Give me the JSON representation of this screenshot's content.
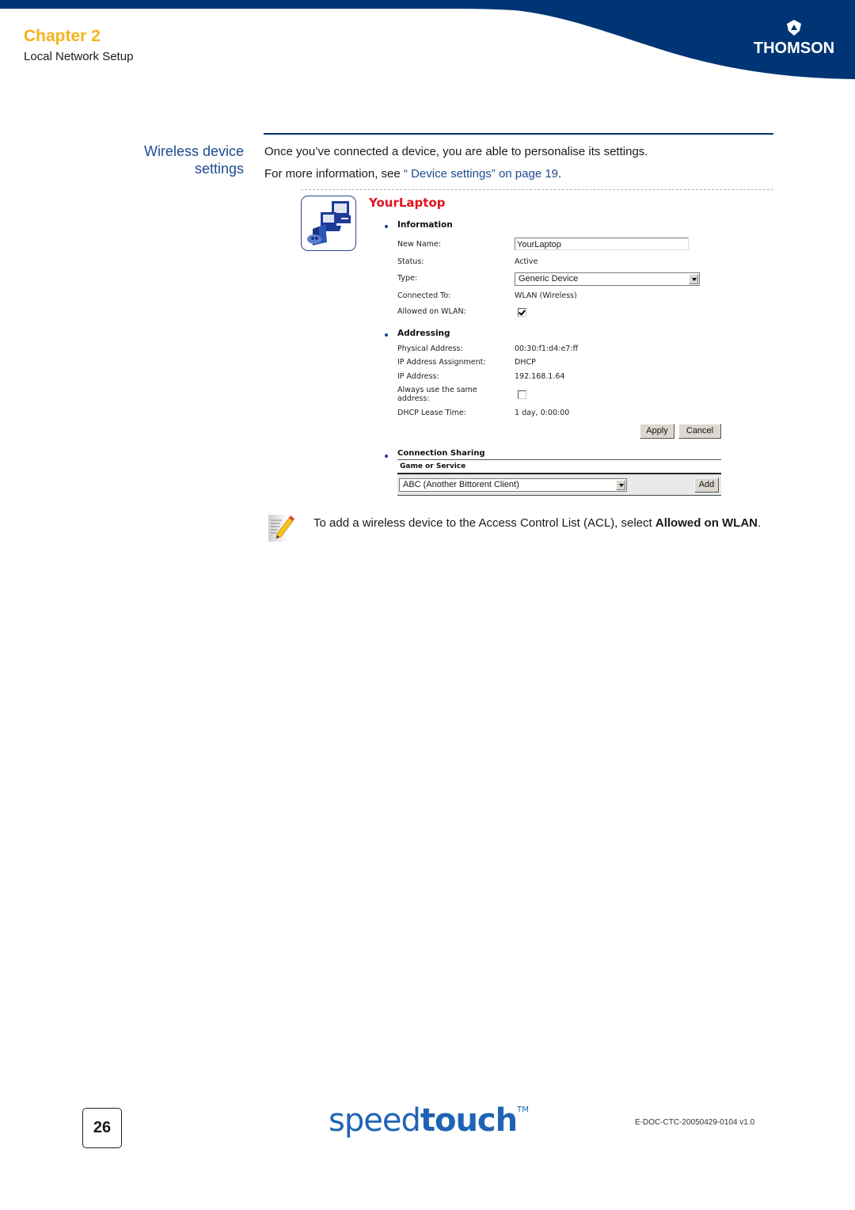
{
  "header": {
    "chapter_label": "Chapter 2",
    "chapter_subtitle": "Local Network Setup",
    "brand_logo_text": "THOMSON",
    "brand_logo_icon": "thomson-triangle-mark",
    "band_color": "#003575",
    "chapter_color": "#f5b21a"
  },
  "section": {
    "heading_line1": "Wireless device",
    "heading_line2": "settings",
    "intro_text": "Once you’ve connected a device, you are able to personalise its settings.",
    "more_info_prefix": "For more information, see ",
    "more_info_link": "“ Device settings” on page 19",
    "more_info_suffix": "."
  },
  "screenshot": {
    "device_icon": "game-console-computers-icon",
    "device_name": "YourLaptop",
    "information": {
      "title": "Information",
      "fields": {
        "new_name_label": "New Name:",
        "new_name_value": "YourLaptop",
        "status_label": "Status:",
        "status_value": "Active",
        "type_label": "Type:",
        "type_value": "Generic Device",
        "connected_to_label": "Connected To:",
        "connected_to_value": "WLAN (Wireless)",
        "allowed_on_wlan_label": "Allowed on WLAN:",
        "allowed_on_wlan_checked": true
      }
    },
    "addressing": {
      "title": "Addressing",
      "fields": {
        "physical_address_label": "Physical Address:",
        "physical_address_value": "00:30:f1:d4:e7:ff",
        "ip_assignment_label": "IP Address Assignment:",
        "ip_assignment_value": "DHCP",
        "ip_address_label": "IP Address:",
        "ip_address_value": "192.168.1.64",
        "always_same_label_1": "Always use the same",
        "always_same_label_2": "address:",
        "always_same_checked": false,
        "lease_time_label": "DHCP Lease Time:",
        "lease_time_value": "1 day, 0:00:00"
      },
      "apply_label": "Apply",
      "cancel_label": "Cancel"
    },
    "connection_sharing": {
      "title": "Connection Sharing",
      "column_header": "Game or Service",
      "selected_service": "ABC (Another Bittorent Client)",
      "add_label": "Add"
    }
  },
  "note": {
    "icon": "note-pencil-icon",
    "text_prefix": "To add a wireless device to the Access Control List (ACL), select ",
    "text_bold": "Allowed on WLAN",
    "text_suffix": "."
  },
  "footer": {
    "page_number": "26",
    "product_logo_light": "speed",
    "product_logo_bold": "touch",
    "product_logo_tm": "TM",
    "document_id": "E-DOC-CTC-20050429-0104 v1.0"
  }
}
